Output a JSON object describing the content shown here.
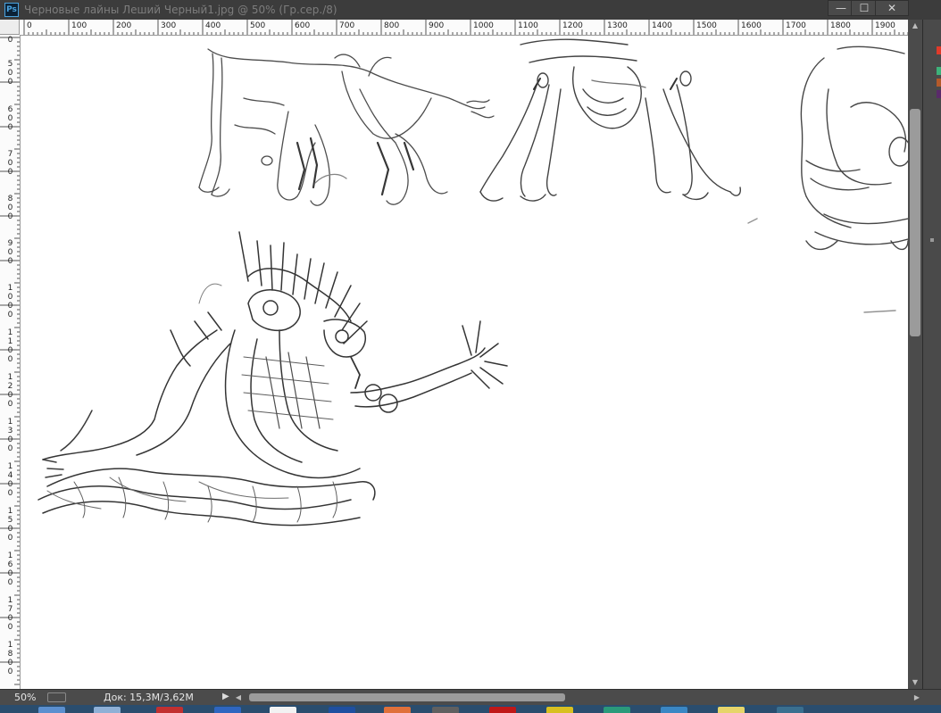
{
  "window": {
    "app_icon": "Ps",
    "title": "Черновые лайны Леший Черный1.jpg @ 50% (Гр.сер./8)",
    "controls": {
      "minimize": "—",
      "maximize": "☐",
      "close": "✕"
    }
  },
  "ruler": {
    "horizontal_labels": [
      "0",
      "100",
      "200",
      "300",
      "400",
      "500",
      "600",
      "700",
      "800",
      "900",
      "1000",
      "1100",
      "1200",
      "1300",
      "1400",
      "1500",
      "1600",
      "1700",
      "1800",
      "1900"
    ],
    "vertical_labels": [
      "0",
      "500",
      "600",
      "700",
      "800",
      "900",
      "1000",
      "1100",
      "1200",
      "1300",
      "1400",
      "1500",
      "1600",
      "1700",
      "1800"
    ]
  },
  "swatch_colors": [
    "#e03a2a",
    "#3db27a",
    "#b45a2a",
    "#5a2a6a"
  ],
  "status": {
    "zoom": "50%",
    "doc_size": "Док: 15,3M/3,62M",
    "play_icon": "▶"
  },
  "taskbar": {
    "item_colors": [
      "#5b8fcf",
      "#8fb0d6",
      "#c23030",
      "#2f66c0",
      "#f2f2f2",
      "#1f4fa0",
      "#e0703a",
      "#606060",
      "#c01818",
      "#d8c020",
      "#2a9a7a",
      "#3a87c4",
      "#e6d56a",
      "#3a6f8f"
    ]
  }
}
